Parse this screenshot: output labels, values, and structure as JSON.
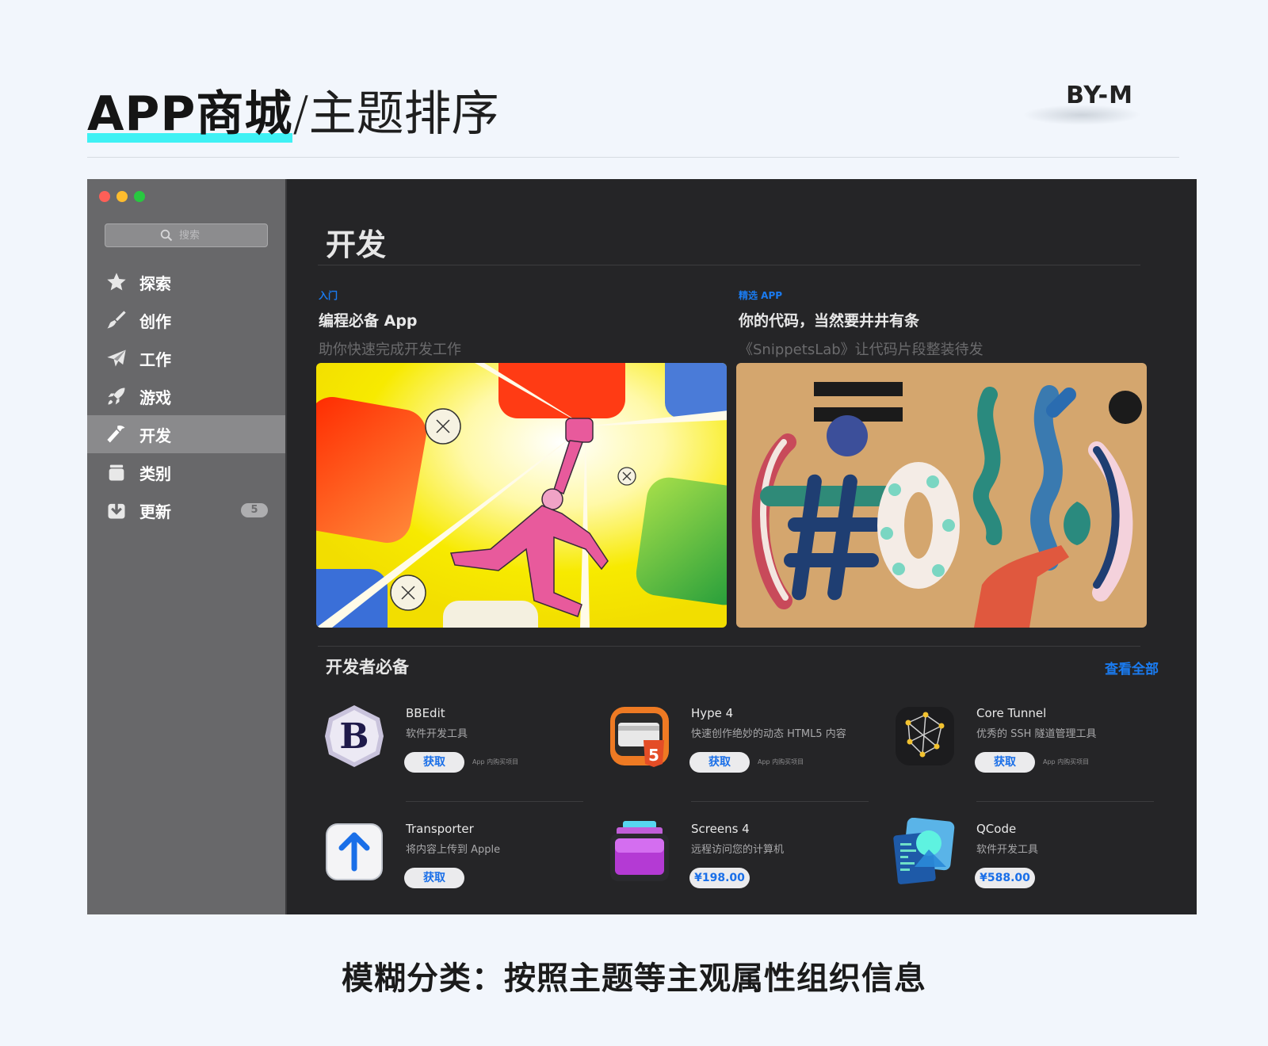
{
  "slide": {
    "title_bold": "APP商城",
    "title_light": "/主题排序",
    "byline": "BY-M",
    "caption": "模糊分类：按照主题等主观属性组织信息"
  },
  "window": {
    "search_placeholder": "搜索",
    "sidebar": {
      "items": [
        {
          "label": "探索",
          "icon": "star-icon"
        },
        {
          "label": "创作",
          "icon": "brush-icon"
        },
        {
          "label": "工作",
          "icon": "paper-plane-icon"
        },
        {
          "label": "游戏",
          "icon": "rocket-icon"
        },
        {
          "label": "开发",
          "icon": "hammer-icon",
          "active": true
        },
        {
          "label": "类别",
          "icon": "stack-icon"
        },
        {
          "label": "更新",
          "icon": "download-icon",
          "badge": "5"
        }
      ]
    },
    "main": {
      "page_title": "开发",
      "features": [
        {
          "eyebrow": "入门",
          "title": "编程必备 App",
          "subtitle": "助你快速完成开发工作"
        },
        {
          "eyebrow": "精选 APP",
          "title": "你的代码，当然要井井有条",
          "subtitle": "《SnippetsLab》让代码片段整装待发"
        }
      ],
      "section_title": "开发者必备",
      "see_all": "查看全部",
      "apps": [
        {
          "name": "BBEdit",
          "desc": "软件开发工具",
          "button": "获取",
          "iap": "App 内购买项目"
        },
        {
          "name": "Hype 4",
          "desc": "快速创作绝妙的动态 HTML5 内容",
          "button": "获取",
          "iap": "App 内购买项目"
        },
        {
          "name": "Core Tunnel",
          "desc": "优秀的 SSH 隧道管理工具",
          "button": "获取",
          "iap": "App 内购买项目"
        },
        {
          "name": "Transporter",
          "desc": "将内容上传到 Apple",
          "button": "获取",
          "iap": ""
        },
        {
          "name": "Screens 4",
          "desc": "远程访问您的计算机",
          "button": "¥198.00",
          "iap": ""
        },
        {
          "name": "QCode",
          "desc": "软件开发工具",
          "button": "¥588.00",
          "iap": ""
        }
      ]
    }
  },
  "colors": {
    "accent_blue": "#1a7bf0",
    "highlight_cyan": "#3ff1f4",
    "window_bg": "#252527",
    "sidebar_bg": "#68686a"
  }
}
